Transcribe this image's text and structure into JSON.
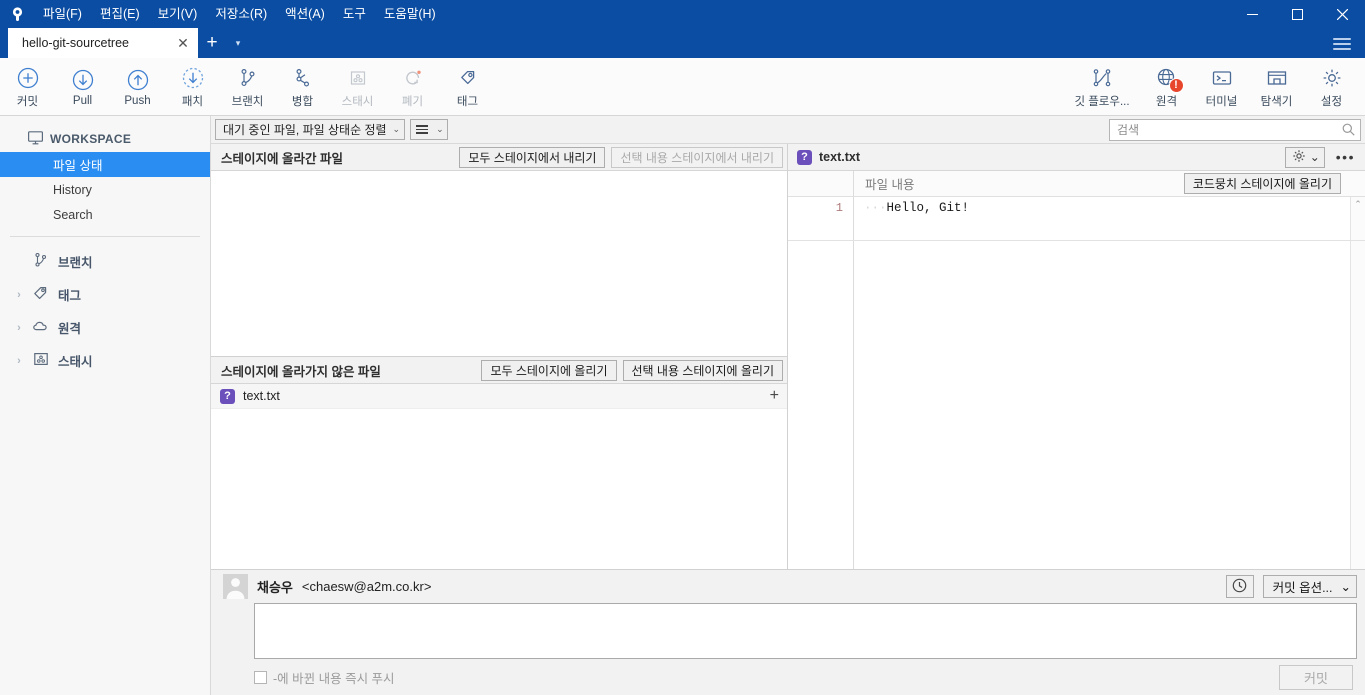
{
  "window": {
    "menus": [
      {
        "label": "파일(F)",
        "name": "menu-file"
      },
      {
        "label": "편집(E)",
        "name": "menu-edit"
      },
      {
        "label": "보기(V)",
        "name": "menu-view"
      },
      {
        "label": "저장소(R)",
        "name": "menu-repository"
      },
      {
        "label": "액션(A)",
        "name": "menu-actions"
      },
      {
        "label": "도구",
        "name": "menu-tools"
      },
      {
        "label": "도움말(H)",
        "name": "menu-help"
      }
    ],
    "minimize": "—",
    "maximize": "□",
    "close": "✕",
    "accent_color": "#0b4da2"
  },
  "tabs": {
    "items": [
      {
        "label": "hello-git-sourcetree"
      }
    ],
    "close_label": "✕",
    "add_label": "+",
    "dropdown_label": "▾"
  },
  "toolbar": {
    "left": [
      {
        "label": "커밋",
        "icon": "commit-icon",
        "disabled": false
      },
      {
        "label": "Pull",
        "icon": "pull-icon",
        "disabled": false
      },
      {
        "label": "Push",
        "icon": "push-icon",
        "disabled": false
      },
      {
        "label": "패치",
        "icon": "fetch-icon",
        "disabled": false
      },
      {
        "label": "브랜치",
        "icon": "branch-icon",
        "disabled": false
      },
      {
        "label": "병합",
        "icon": "merge-icon",
        "disabled": false
      },
      {
        "label": "스태시",
        "icon": "stash-icon",
        "disabled": true
      },
      {
        "label": "폐기",
        "icon": "discard-icon",
        "disabled": true
      },
      {
        "label": "태그",
        "icon": "tag-icon",
        "disabled": false
      }
    ],
    "right": [
      {
        "label": "깃 플로우...",
        "icon": "gitflow-icon",
        "badge": ""
      },
      {
        "label": "원격",
        "icon": "remote-globe-icon",
        "badge": "!"
      },
      {
        "label": "터미널",
        "icon": "terminal-icon",
        "badge": ""
      },
      {
        "label": "탐색기",
        "icon": "explorer-icon",
        "badge": ""
      },
      {
        "label": "설정",
        "icon": "settings-gear-icon",
        "badge": ""
      }
    ]
  },
  "sidebar": {
    "workspace_label": "WORKSPACE",
    "children": [
      {
        "label": "파일 상태",
        "active": true
      },
      {
        "label": "History",
        "active": false
      },
      {
        "label": "Search",
        "active": false
      }
    ],
    "nodes": [
      {
        "label": "브랜치",
        "icon": "branch-icon",
        "caret": ""
      },
      {
        "label": "태그",
        "icon": "tag-icon",
        "caret": "›"
      },
      {
        "label": "원격",
        "icon": "cloud-icon",
        "caret": "›"
      },
      {
        "label": "스태시",
        "icon": "stash-icon",
        "caret": "›"
      }
    ]
  },
  "filterbar": {
    "sort_label": "대기 중인 파일, 파일 상태순 정렬",
    "sort_chevron": "⌄",
    "view_chevron": "⌄"
  },
  "search": {
    "placeholder": "검색",
    "value": ""
  },
  "staged": {
    "title": "스테이지에 올라간 파일",
    "unstage_all_label": "모두 스테이지에서 내리기",
    "unstage_selected_label": "선택 내용 스테이지에서 내리기",
    "files": []
  },
  "unstaged": {
    "title": "스테이지에 올라가지 않은 파일",
    "stage_all_label": "모두 스테이지에 올리기",
    "stage_selected_label": "선택 내용 스테이지에 올리기",
    "files": [
      {
        "name": "text.txt",
        "status": "?",
        "status_color": "#6b4fbb",
        "add_label": "+"
      }
    ]
  },
  "diff": {
    "filename": "text.txt",
    "status": "?",
    "gear_chevron": "⌄",
    "overflow_label": "•••",
    "content_header": "파일 내용",
    "stage_hunk_label": "코드뭉치 스테이지에 올리기",
    "lines": [
      {
        "number": "1",
        "leading_ws": "···",
        "text": "Hello, Git!"
      }
    ],
    "scroll_up": "⌃"
  },
  "commit": {
    "author_name": "채승우",
    "author_email": "<chaesw@a2m.co.kr>",
    "history_icon": "clock-icon",
    "options_label": "커밋 옵션...",
    "options_chevron": "⌄",
    "message_value": "",
    "push_checkbox_label": "-에 바뀐 내용 즉시 푸시",
    "commit_button_label": "커밋"
  }
}
